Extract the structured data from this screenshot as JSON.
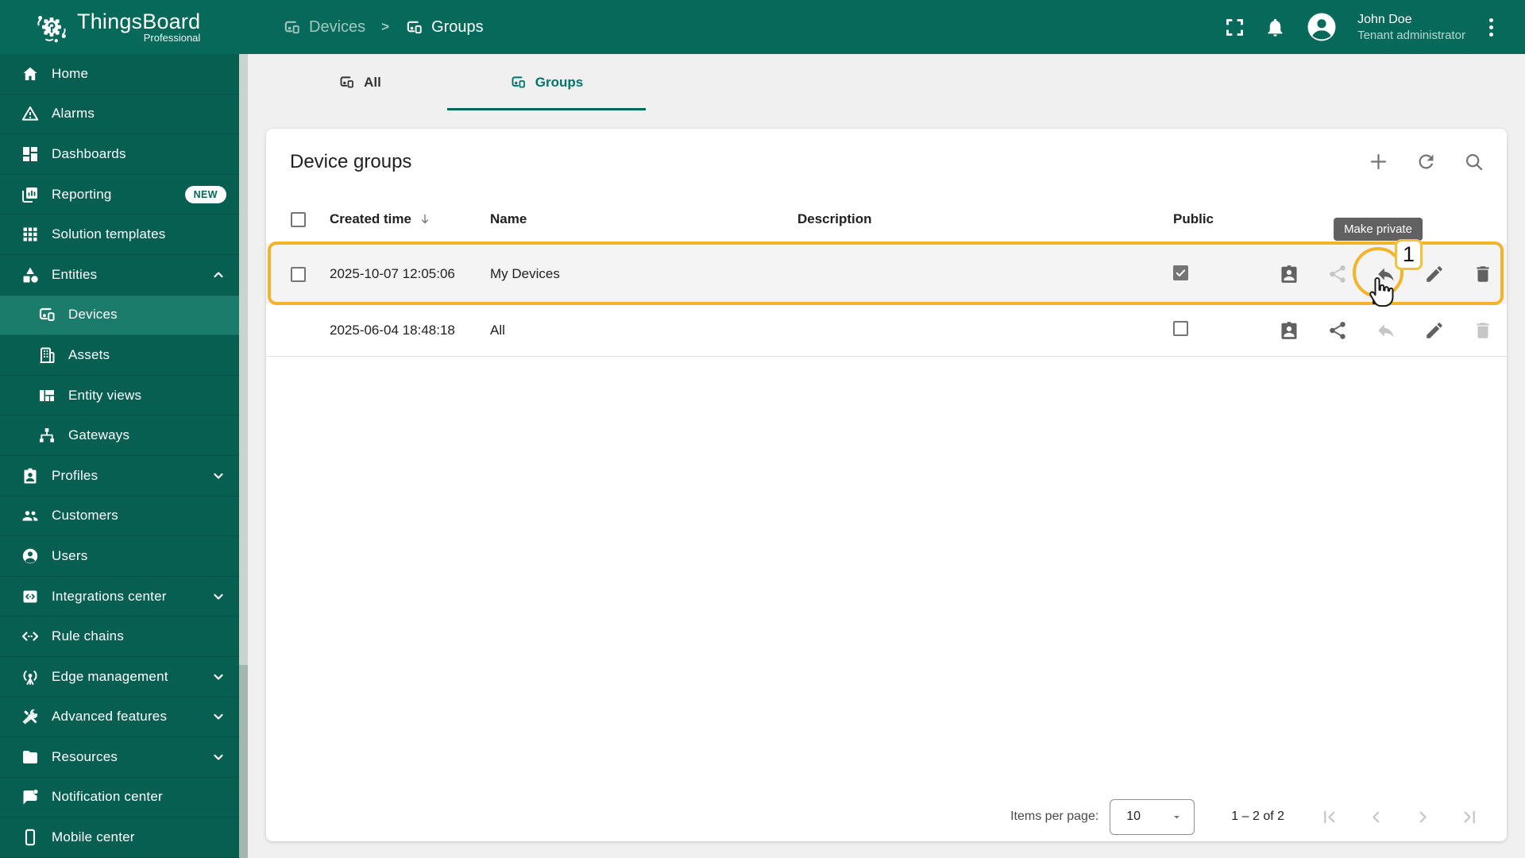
{
  "app": {
    "name": "ThingsBoard",
    "edition": "Professional"
  },
  "header": {
    "breadcrumb": [
      {
        "label": "Devices",
        "icon": "devices-icon"
      },
      {
        "label": "Groups",
        "icon": "devices-icon"
      }
    ],
    "separator": ">",
    "icons": [
      "fullscreen-icon",
      "notifications-bell-icon"
    ],
    "user": {
      "name": "John Doe",
      "role": "Tenant administrator"
    }
  },
  "sidebar": {
    "items": [
      {
        "label": "Home",
        "icon": "home-icon"
      },
      {
        "label": "Alarms",
        "icon": "alarms-warning-icon"
      },
      {
        "label": "Dashboards",
        "icon": "dashboards-icon"
      },
      {
        "label": "Reporting",
        "icon": "reporting-icon",
        "badge": "NEW"
      },
      {
        "label": "Solution templates",
        "icon": "solution-templates-icon"
      },
      {
        "label": "Entities",
        "icon": "entities-icon",
        "expanded": true
      },
      {
        "label": "Devices",
        "icon": "devices-icon",
        "active": true,
        "indent": true
      },
      {
        "label": "Assets",
        "icon": "assets-icon",
        "indent": true
      },
      {
        "label": "Entity views",
        "icon": "entity-views-icon",
        "indent": true
      },
      {
        "label": "Gateways",
        "icon": "gateways-icon",
        "indent": true
      },
      {
        "label": "Profiles",
        "icon": "profiles-icon",
        "collapsed": true
      },
      {
        "label": "Customers",
        "icon": "customers-icon"
      },
      {
        "label": "Users",
        "icon": "users-icon"
      },
      {
        "label": "Integrations center",
        "icon": "integrations-icon",
        "collapsed": true
      },
      {
        "label": "Rule chains",
        "icon": "rule-chains-icon"
      },
      {
        "label": "Edge management",
        "icon": "edge-icon",
        "collapsed": true
      },
      {
        "label": "Advanced features",
        "icon": "advanced-features-icon",
        "collapsed": true
      },
      {
        "label": "Resources",
        "icon": "resources-icon",
        "collapsed": true
      },
      {
        "label": "Notification center",
        "icon": "notification-icon"
      },
      {
        "label": "Mobile center",
        "icon": "mobile-icon"
      }
    ]
  },
  "tabs": [
    {
      "label": "All",
      "icon": "devices-icon",
      "active": false
    },
    {
      "label": "Groups",
      "icon": "devices-icon",
      "active": true
    }
  ],
  "page": {
    "title": "Device groups",
    "toolbar_icons": [
      "add-icon",
      "refresh-icon",
      "search-icon"
    ],
    "table": {
      "columns": {
        "created": "Created time",
        "name": "Name",
        "description": "Description",
        "public": "Public"
      },
      "sort": {
        "column": "created",
        "direction": "desc"
      },
      "row_action_icons": [
        "group-permissions-icon",
        "share-icon",
        "make-private-icon",
        "edit-icon",
        "delete-icon"
      ],
      "rows": [
        {
          "created": "2025-10-07 12:05:06",
          "name": "My Devices",
          "description": "",
          "public": true,
          "highlighted": true
        },
        {
          "created": "2025-06-04 18:48:18",
          "name": "All",
          "description": "",
          "public": false,
          "highlighted": false
        }
      ]
    },
    "pagination": {
      "items_per_page_label": "Items per page:",
      "page_size": "10",
      "range": "1 – 2 of 2"
    }
  },
  "tooltip": {
    "text": "Make private"
  },
  "annotation": {
    "step_label": "1",
    "color": "#F5B32B"
  },
  "colors": {
    "header_teal": "#07695A",
    "sidebar_teal": "#075F51",
    "sidebar_active_teal": "#1B7C6C",
    "accent_teal": "#00756A",
    "content_background": "#F0F0F0",
    "annotation_orange": "#F5B32B",
    "tooltip_background": "#616161",
    "icon_enabled": "#616161",
    "icon_disabled": "#C6C6C6"
  }
}
